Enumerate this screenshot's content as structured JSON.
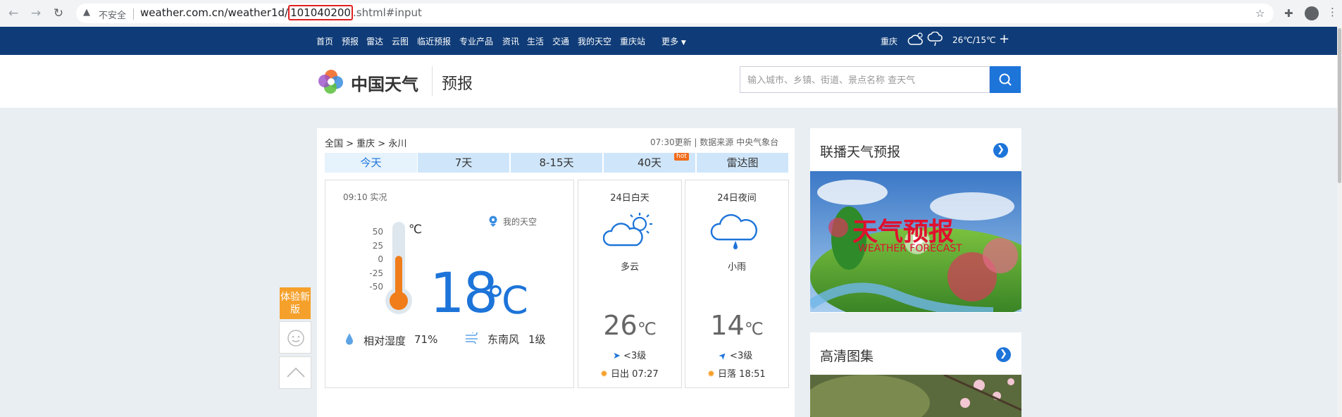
{
  "browser": {
    "security_label": "不安全",
    "url_prefix": "weather.com.cn/weather1d/",
    "url_highlight": "101040200",
    "url_suffix": ".shtml#input"
  },
  "nav": {
    "items": [
      "首页",
      "预报",
      "雷达",
      "云图",
      "临近预报",
      "专业产品",
      "资讯",
      "生活",
      "交通",
      "我的天空",
      "重庆站",
      "更多"
    ],
    "city": "重庆",
    "temp_range": "26℃/15℃",
    "plus": "+"
  },
  "header": {
    "logo_text": "中国天气",
    "subtitle": "预报",
    "search_placeholder": "输入城市、乡镇、街道、景点名称 查天气"
  },
  "breadcrumb": "全国 > 重庆 > 永川",
  "update_info": "07:30更新 | 数据来源 中央气象台",
  "tabs": [
    "今天",
    "7天",
    "8-15天",
    "40天",
    "雷达图"
  ],
  "hot_badge": "hot",
  "current": {
    "obs_time": "09:10 实况",
    "scale": [
      "50",
      "25",
      "0",
      "-25",
      "-50"
    ],
    "unit_small": "℃",
    "my_sky": "我的天空",
    "temperature": "18",
    "unit": "℃",
    "thermometer_fill_fraction": 0.59,
    "humidity_label": "相对湿度",
    "humidity_value": "71%",
    "wind_direction": "东南风",
    "wind_level": "1级"
  },
  "day": {
    "title": "24日白天",
    "desc": "多云",
    "temp": "26",
    "unit": "℃",
    "wind": "<3级",
    "sun_label": "日出 07:27"
  },
  "night": {
    "title": "24日夜间",
    "desc": "小雨",
    "temp": "14",
    "unit": "℃",
    "wind": "<3级",
    "sun_label": "日落 18:51"
  },
  "side": {
    "try_new": "体验新版"
  },
  "right": {
    "video_title": "联播天气预报",
    "video_caption": "天气预报",
    "video_caption_en": "WEATHER FORECAST",
    "gallery_title": "高清图集"
  },
  "colors": {
    "nav_bg": "#0f3c78",
    "accent": "#1d74d9",
    "thermo_fill": "#f07d1a",
    "try_new_bg": "#f5a02a"
  }
}
